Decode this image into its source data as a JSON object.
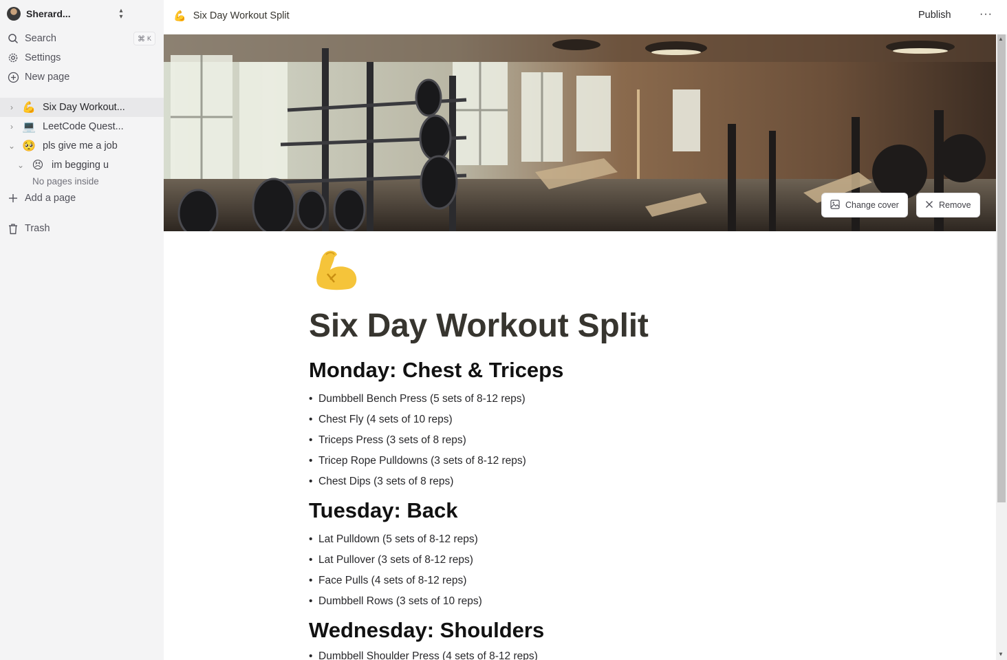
{
  "workspace": {
    "name": "Sherard..."
  },
  "nav": {
    "search": "Search",
    "search_shortcut_cmd": "⌘",
    "search_shortcut_key": "K",
    "settings": "Settings",
    "new_page": "New page"
  },
  "tree": [
    {
      "label": "Six Day Workout...",
      "emoji": "💪"
    },
    {
      "label": "LeetCode Quest...",
      "emoji": "💻"
    },
    {
      "label": "pls give me a job",
      "emoji": "🥺"
    },
    {
      "label": "im begging u",
      "emoji": "😣"
    }
  ],
  "no_pages": "No pages inside",
  "add_page": "Add a page",
  "trash": "Trash",
  "topbar": {
    "breadcrumb": "Six Day Workout Split",
    "breadcrumb_emoji": "💪",
    "publish": "Publish",
    "more": "···"
  },
  "cover": {
    "change_cover": "Change cover",
    "remove": "Remove"
  },
  "page": {
    "title": "Six Day Workout Split",
    "sections": [
      {
        "heading": "Monday: Chest & Triceps",
        "items": [
          "Dumbbell Bench Press (5 sets of 8-12 reps)",
          "Chest Fly (4 sets of 10 reps)",
          "Triceps Press (3 sets of 8 reps)",
          "Tricep Rope Pulldowns (3 sets of 8-12 reps)",
          "Chest Dips (3 sets of 8 reps)"
        ]
      },
      {
        "heading": "Tuesday: Back",
        "items": [
          "Lat Pulldown (5 sets of 8-12 reps)",
          "Lat Pullover (3 sets of 8-12 reps)",
          "Face Pulls (4 sets of 8-12 reps)",
          "Dumbbell Rows (3 sets of 10 reps)"
        ]
      },
      {
        "heading": "Wednesday: Shoulders",
        "items": [
          "Dumbbell Shoulder Press (4 sets of 8-12 reps)"
        ]
      }
    ]
  }
}
